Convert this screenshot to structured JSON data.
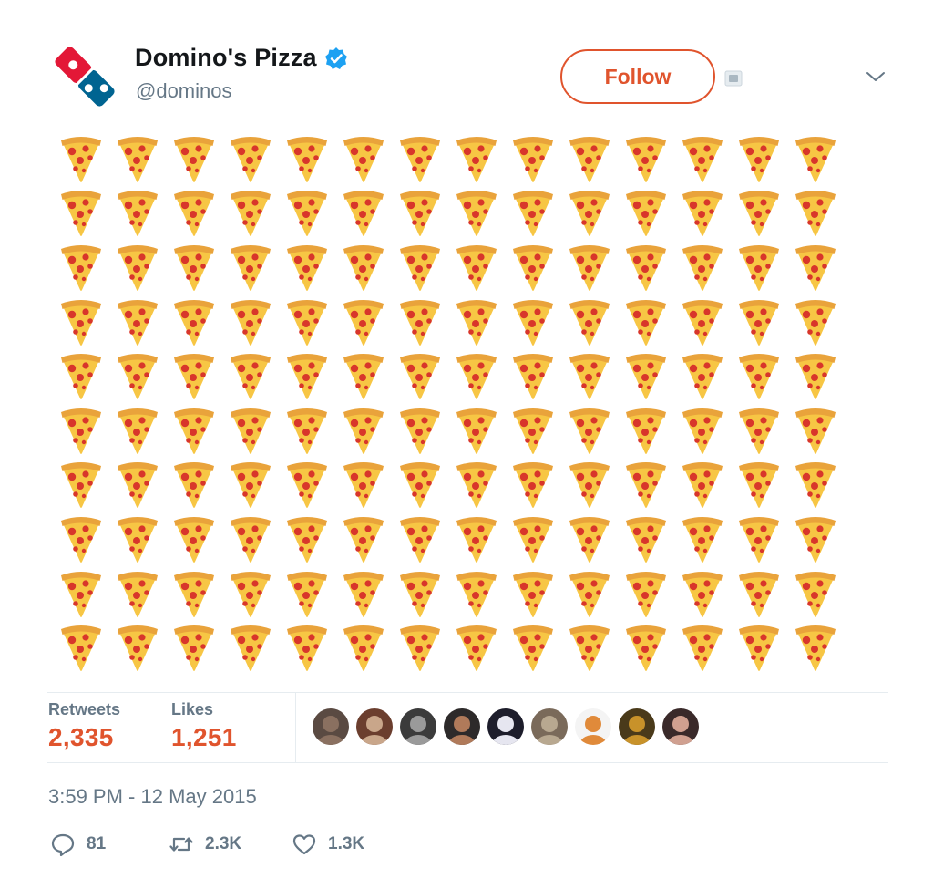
{
  "header": {
    "display_name": "Domino's Pizza",
    "handle": "@dominos",
    "follow_label": "Follow",
    "verified_icon": "verified-badge-icon",
    "logo": "dominos-logo"
  },
  "colors": {
    "accent": "#e0542d",
    "verified": "#1da1f2",
    "logo_red": "#e31837",
    "logo_blue": "#006491",
    "muted": "#657786"
  },
  "tweet": {
    "content_icon": "pizza-slice-emoji",
    "rows": 10,
    "columns": 14
  },
  "stats": {
    "retweets_label": "Retweets",
    "retweets_value": "2,335",
    "likes_label": "Likes",
    "likes_value": "1,251",
    "liker_avatars": [
      "avatar-1",
      "avatar-2",
      "avatar-3",
      "avatar-4",
      "avatar-5",
      "avatar-6",
      "avatar-7",
      "avatar-8",
      "avatar-9"
    ]
  },
  "timestamp": "3:59 PM - 12 May 2015",
  "actions": {
    "reply_count": "81",
    "retweet_count": "2.3K",
    "like_count": "1.3K"
  }
}
